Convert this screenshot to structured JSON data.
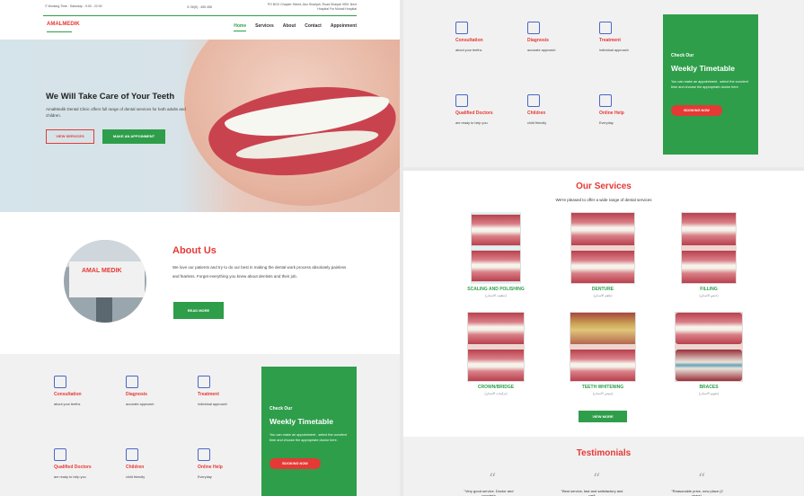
{
  "left": {
    "topbar": {
      "hours": "© Working Time : Saturday - 9:00 - 22:00",
      "phone": "✆ 06(5) - 455 458",
      "address": "PO BOX Chapter Street, Abu Sharijah, Road Sharjah 9501 Next Hospital For Mohali Hospital"
    },
    "logo_text": "AMALMEDIK",
    "menu": [
      "Home",
      "Services",
      "About",
      "Contact",
      "Appoinment"
    ],
    "hero": {
      "title": "We Will Take Care of Your Teeth",
      "text": "AmalMedik Dental Clinic offers full range of dental services for both adults and children.",
      "btn_view": "VIEW SERVICES",
      "btn_appointment": "MAKE AN APPOINMENT"
    },
    "about": {
      "photo_sign": "AMAL MEDIK",
      "title": "About Us",
      "text": "We love our patients and try to do our best in making the dental work process absolutely painless and fearless. Forget everything you knew about dentists and their job.",
      "btn": "READ MORE"
    }
  },
  "features": [
    {
      "title": "Consultation",
      "desc": "about your teeths",
      "icon": "clipboard-icon"
    },
    {
      "title": "Diagnosis",
      "desc": "accurate approach",
      "icon": "chart-icon"
    },
    {
      "title": "Treatment",
      "desc": "individual approach",
      "icon": "tooth-doc-icon"
    },
    {
      "title": "Qualified Doctors",
      "desc": "are ready to help you",
      "icon": "doctor-icon"
    },
    {
      "title": "Children",
      "desc": "child friendly",
      "icon": "child-icon"
    },
    {
      "title": "Online Help",
      "desc": "Everyday",
      "icon": "heart-hand-icon"
    }
  ],
  "timetable": {
    "check": "Check Our",
    "title": "Weekly Timetable",
    "text": "You can make an appointment , select the convient time and choose the appropriate doctor here.",
    "btn": "BOOKING NOW"
  },
  "services": {
    "title": "Our Services",
    "subtitle": "We're pleased to offer a wide range of dental services",
    "items": [
      {
        "name": "SCALING AND POLISHING",
        "arabic": "(تنظيف الاسنان)"
      },
      {
        "name": "DENTURE",
        "arabic": "(طقم الاسنان)"
      },
      {
        "name": "FILLING",
        "arabic": "(حشو الاسنان)"
      },
      {
        "name": "CROWN/BRIDGE",
        "arabic": "(تركيبات الاسنان)"
      },
      {
        "name": "TEETH WHITENING",
        "arabic": "(تبييض الاسنان)"
      },
      {
        "name": "BRACES",
        "arabic": "(تقويم الاسنان)"
      }
    ],
    "btn": "VIEW MORE"
  },
  "testimonials": {
    "title": "Testimonials",
    "quotes": [
      "\"Very good service. Doctor and counter's",
      "\"Best service, fast and satisfactory and well",
      "\"Reasonable price, new place (2 years),"
    ]
  }
}
